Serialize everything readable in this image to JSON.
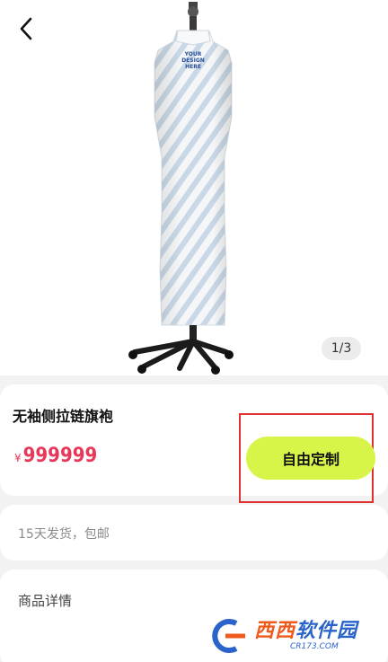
{
  "gallery": {
    "page_indicator": "1/3",
    "design_placeholder": [
      "YOUR",
      "DESIGN",
      "HERE"
    ]
  },
  "product": {
    "title": "无袖侧拉链旗袍",
    "currency": "¥",
    "price": "999999",
    "customize_label": "自由定制"
  },
  "shipping": {
    "text": "15天发货，包邮"
  },
  "details": {
    "title": "商品详情"
  },
  "watermark": {
    "brand_a": "西西",
    "brand_b": "软件园",
    "url": "CR173.COM"
  },
  "colors": {
    "accent_button": "#d6f548",
    "price": "#e8385a",
    "highlight": "#e0302f"
  }
}
